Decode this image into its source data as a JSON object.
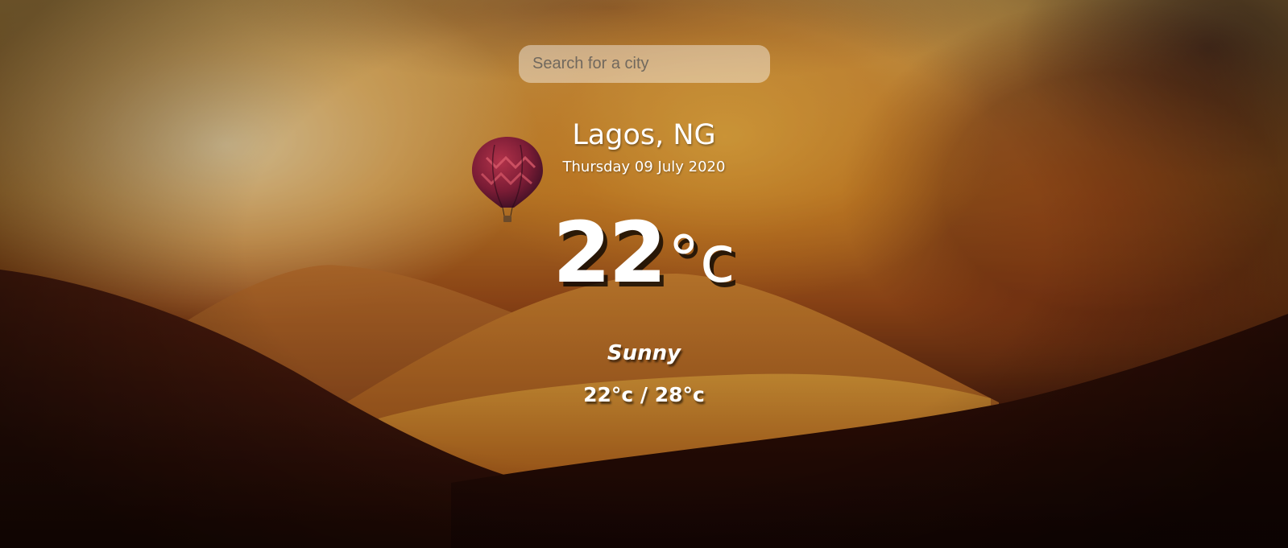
{
  "search": {
    "placeholder": "Search for a city",
    "value": ""
  },
  "location": {
    "city": "Lagos, NG",
    "date": "Thursday 09 July 2020"
  },
  "current": {
    "temperature": "22",
    "unit": "°c",
    "condition": "Sunny",
    "range": "22°c / 28°c"
  },
  "colors": {
    "text": "#ffffff",
    "search_background": "rgba(255,255,255,0.42)",
    "sky_light": "#e9b35a",
    "hill_dark": "#3a130a"
  },
  "icons": {
    "decoration": "hot-air-balloon"
  }
}
